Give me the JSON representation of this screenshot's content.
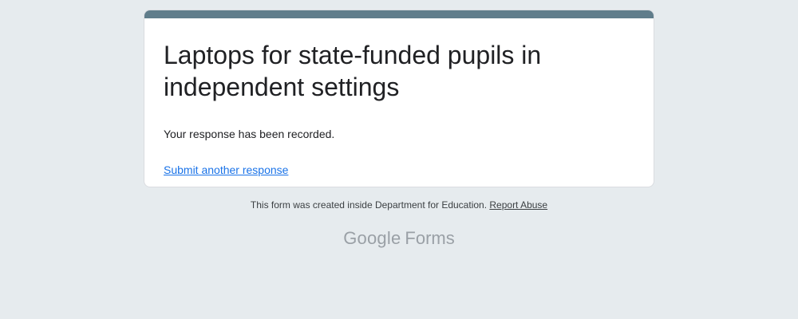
{
  "form": {
    "title": "Laptops for state-funded pupils in independent settings",
    "confirmation": "Your response has been recorded.",
    "submit_another": "Submit another response"
  },
  "footer": {
    "note": "This form was created inside Department for Education.",
    "report_abuse": "Report Abuse"
  },
  "branding": {
    "google": "Google",
    "product": "Forms"
  },
  "colors": {
    "page_background": "#e6ebee",
    "accent_bar": "#607d8b",
    "link": "#1a73e8",
    "text": "#202124",
    "logo_gray": "#9aa0a6"
  }
}
